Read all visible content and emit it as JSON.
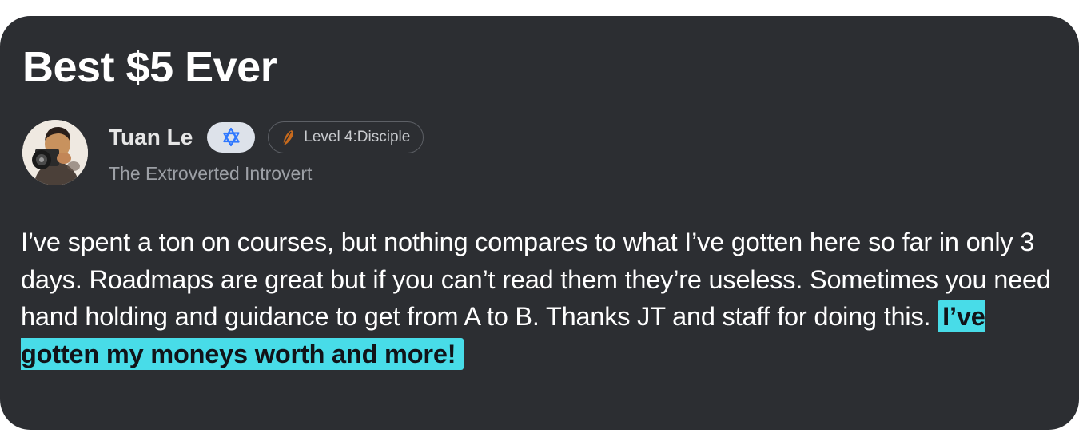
{
  "review": {
    "title": "Best $5 Ever",
    "author": {
      "name": "Tuan Le",
      "subtitle": "The Extroverted Introvert",
      "level": "Level 4:Disciple",
      "ai_badge_icon": "atom-icon",
      "level_icon": "feather-icon"
    },
    "body": "I’ve spent a ton on courses, but nothing compares to what I’ve gotten here so far in only 3 days. Roadmaps are great but if you can’t read them they’re useless. Sometimes you need hand holding and guidance to get from A to B. Thanks JT and staff for doing this.",
    "highlight": "I’ve gotten my moneys worth and more!"
  },
  "colors": {
    "card_background": "#2c2e32",
    "highlight": "#48dce8",
    "ai_badge_background": "#dde2ea",
    "ai_badge_icon": "#2f78ff",
    "level_icon": "#c76a1d"
  }
}
